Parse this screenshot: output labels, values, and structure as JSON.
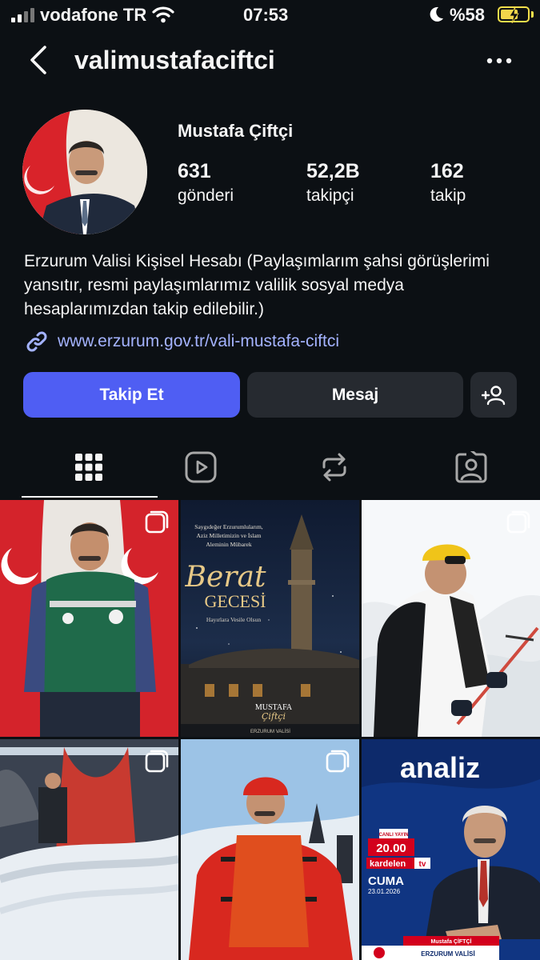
{
  "status_bar": {
    "carrier": "vodafone TR",
    "time": "07:53",
    "battery": "%58",
    "battery_level": 0.58
  },
  "header": {
    "username": "valimustafaciftci"
  },
  "profile": {
    "display_name": "Mustafa Çiftçi",
    "stats": [
      {
        "value": "631",
        "label": "gönderi"
      },
      {
        "value": "52,2B",
        "label": "takipçi"
      },
      {
        "value": "162",
        "label": "takip"
      }
    ],
    "bio": "Erzurum Valisi Kişisel Hesabı (Paylaşımlarım şahsi görüşlerimi yansıtır, resmi paylaşımlarımız valilik sosyal medya hesaplarımızdan takip edilebilir.)",
    "link": "www.erzurum.gov.tr/vali-mustafa-ciftci"
  },
  "actions": {
    "follow": "Takip Et",
    "message": "Mesaj"
  },
  "tabs": [
    "grid-icon",
    "reels-icon",
    "reposts-icon",
    "tagged-icon"
  ],
  "posts": [
    {
      "kind": "photo",
      "multi": true
    },
    {
      "kind": "graphic",
      "multi": false,
      "top_text": "Saygıdeğer Erzurumlularım, Aziz Milletimizin ve İslam Aleminin Mübarek",
      "title_script": "Berat",
      "title": "GECESİ",
      "subtitle": "Hayırlara Vesile Olsun",
      "signature": "MUSTAFA",
      "signature_script": "Çiftçi",
      "footer": "ERZURUM VALİSİ"
    },
    {
      "kind": "photo",
      "multi": true
    },
    {
      "kind": "photo",
      "multi": true
    },
    {
      "kind": "photo",
      "multi": true
    },
    {
      "kind": "graphic",
      "multi": false,
      "brand": "analiz",
      "live": "CANLI YAYIN",
      "hour": "20.00",
      "channel": "kardelen",
      "channel_tag": "tv",
      "day": "CUMA",
      "date": "23.01.2026",
      "guest": "Mustafa ÇİFTÇİ",
      "guest_title": "ERZURUM VALİSİ"
    }
  ],
  "colors": {
    "background": "#0c1014",
    "primary_button": "#4f5ef3",
    "secondary_button": "#262a30",
    "link": "#a4b3ff"
  }
}
